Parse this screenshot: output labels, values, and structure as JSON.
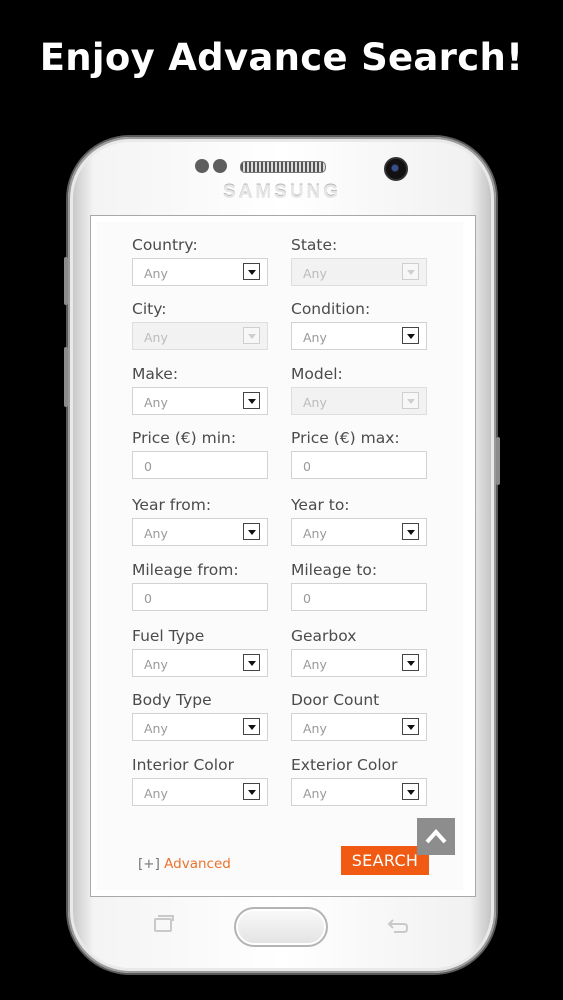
{
  "promo": {
    "title": "Enjoy Advance Search!"
  },
  "phone": {
    "brand": "SAMSUNG"
  },
  "form": {
    "fields": [
      {
        "label": "Country:",
        "type": "select",
        "value": "Any",
        "disabled": false
      },
      {
        "label": "State:",
        "type": "select",
        "value": "Any",
        "disabled": true
      },
      {
        "label": "City:",
        "type": "select",
        "value": "Any",
        "disabled": true
      },
      {
        "label": "Condition:",
        "type": "select",
        "value": "Any",
        "disabled": false
      },
      {
        "label": "Make:",
        "type": "select",
        "value": "Any",
        "disabled": false
      },
      {
        "label": "Model:",
        "type": "select",
        "value": "Any",
        "disabled": true
      },
      {
        "label": "Price (€) min:",
        "type": "text",
        "value": "0"
      },
      {
        "label": "Price (€) max:",
        "type": "text",
        "value": "0"
      },
      {
        "label": "Year from:",
        "type": "select",
        "value": "Any",
        "disabled": false
      },
      {
        "label": "Year to:",
        "type": "select",
        "value": "Any",
        "disabled": false
      },
      {
        "label": "Mileage from:",
        "type": "text",
        "value": "0"
      },
      {
        "label": "Mileage to:",
        "type": "text",
        "value": "0"
      },
      {
        "label": "Fuel Type",
        "type": "select",
        "value": "Any",
        "disabled": false
      },
      {
        "label": "Gearbox",
        "type": "select",
        "value": "Any",
        "disabled": false
      },
      {
        "label": "Body Type",
        "type": "select",
        "value": "Any",
        "disabled": false
      },
      {
        "label": "Door Count",
        "type": "select",
        "value": "Any",
        "disabled": false
      },
      {
        "label": "Interior Color",
        "type": "select",
        "value": "Any",
        "disabled": false
      },
      {
        "label": "Exterior Color",
        "type": "select",
        "value": "Any",
        "disabled": false
      }
    ],
    "advanced_prefix": "[+]",
    "advanced_label": "Advanced",
    "search_label": "SEARCH"
  },
  "icons": {
    "scroll_top": "chevron-up-icon",
    "recent_apps": "recent-apps-icon",
    "back": "back-icon"
  },
  "colors": {
    "accent": "#f05a12",
    "link": "#e8732c",
    "background": "#000000"
  }
}
